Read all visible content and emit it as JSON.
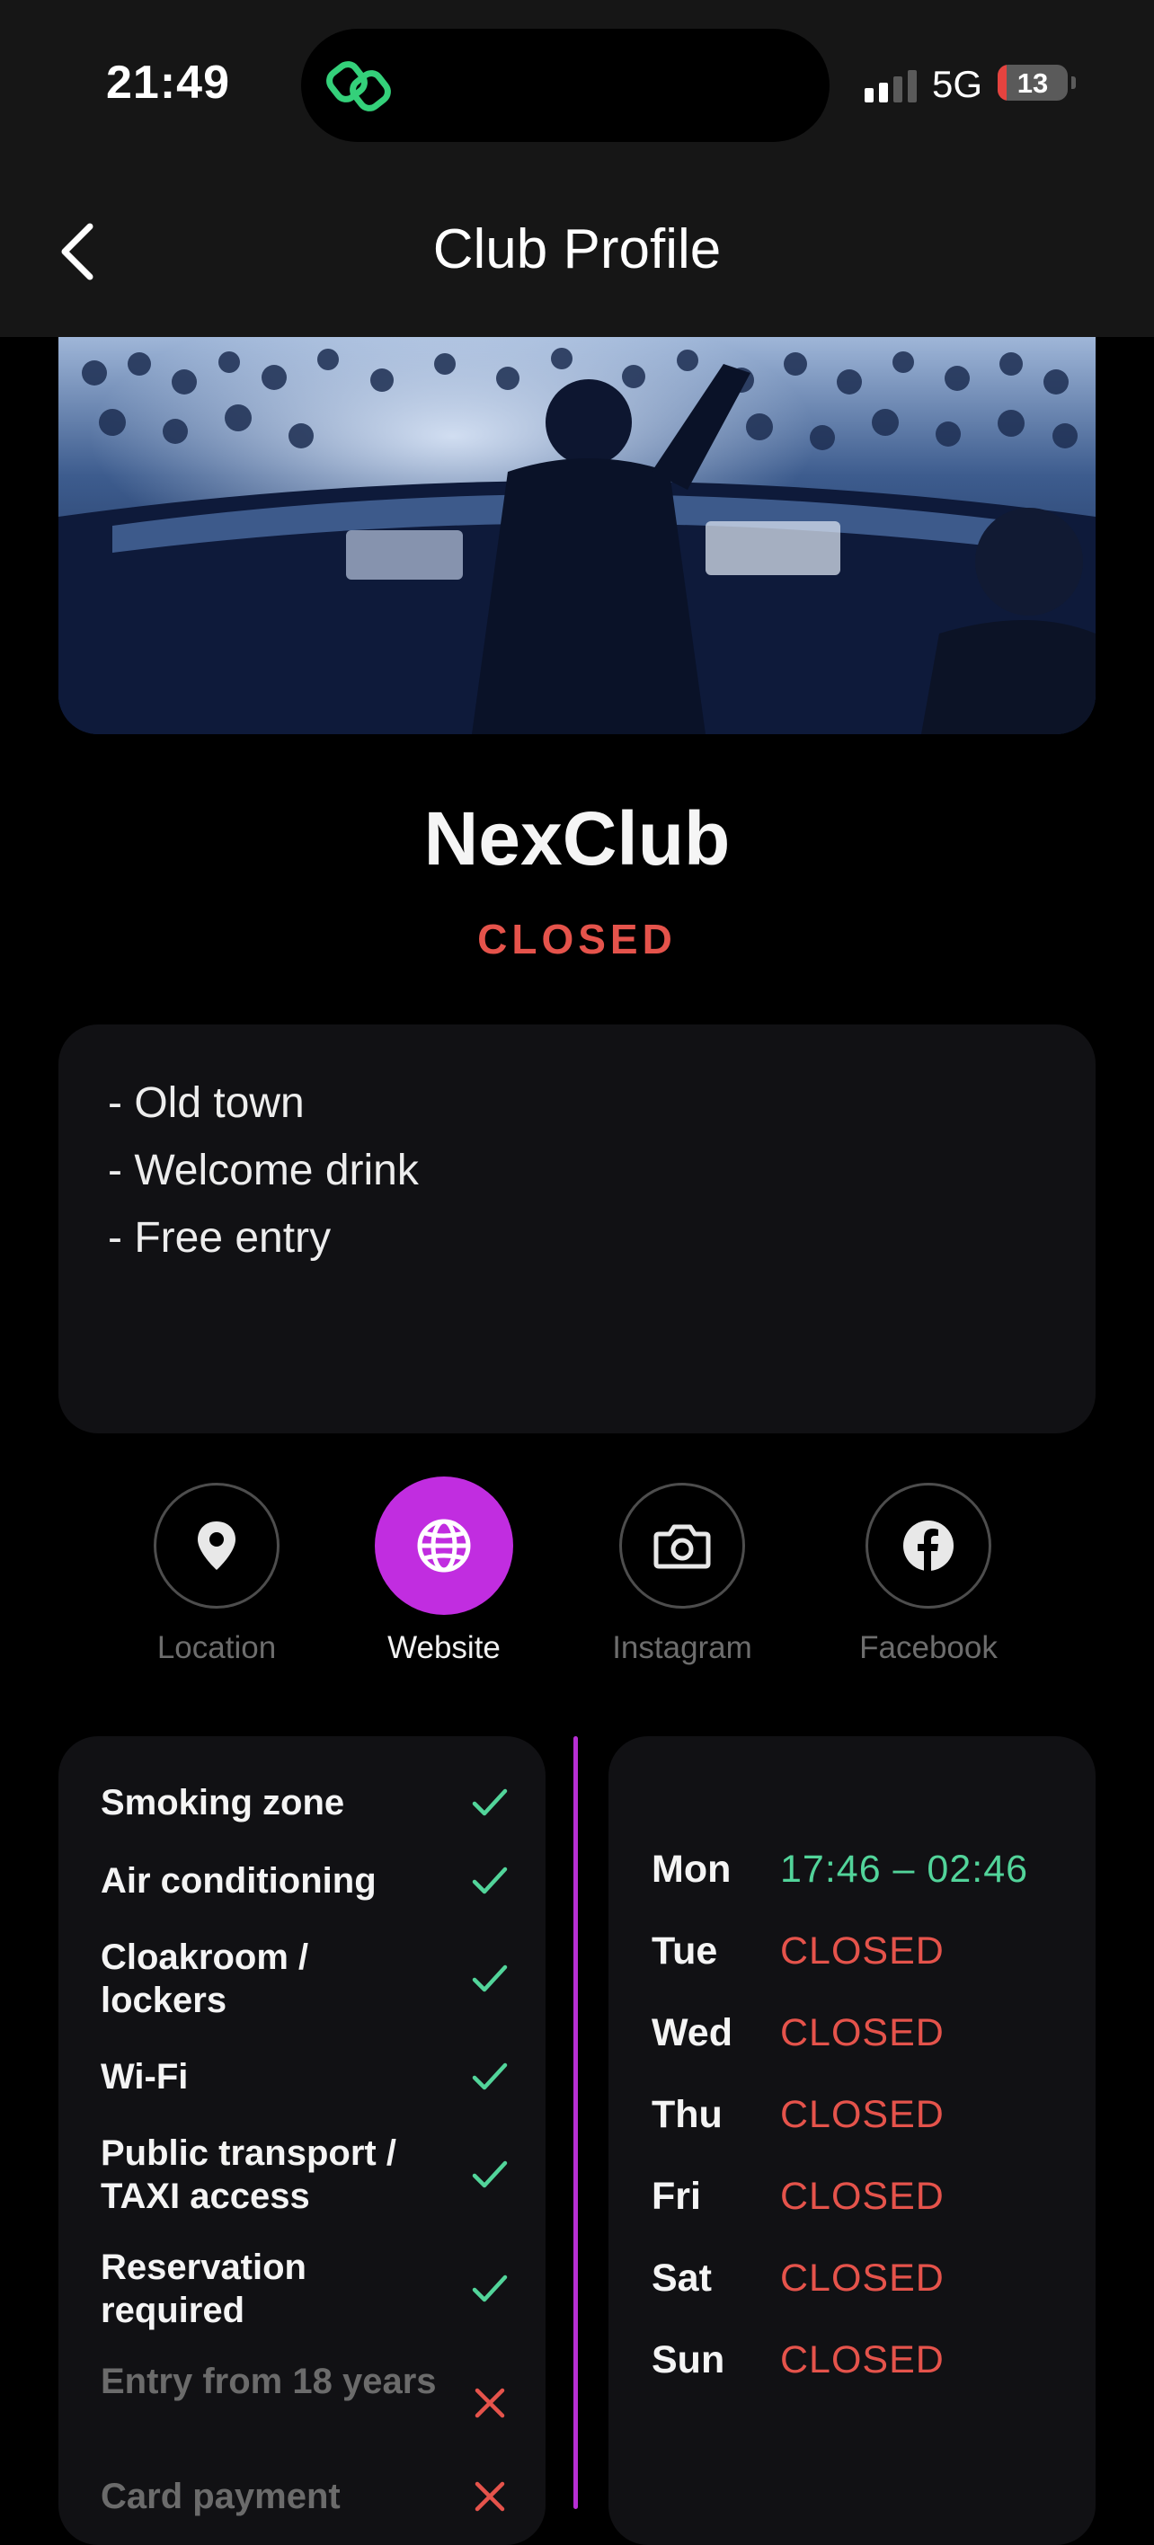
{
  "status_bar": {
    "time": "21:49",
    "network": "5G",
    "battery": "13",
    "battery_level": 0.13,
    "signal_bars_active": 2,
    "signal_bars_total": 4,
    "island_app_icon": "link-rings-icon"
  },
  "header": {
    "back_icon": "chevron-left-icon",
    "title": "Club Profile"
  },
  "club": {
    "name": "NexClub",
    "status": "CLOSED",
    "status_color": "#e5534b",
    "description": [
      "- Old town",
      "- Welcome drink",
      "- Free entry"
    ]
  },
  "actions": [
    {
      "label": "Location",
      "icon": "map-pin-icon",
      "active": false
    },
    {
      "label": "Website",
      "icon": "globe-icon",
      "active": true
    },
    {
      "label": "Instagram",
      "icon": "camera-icon",
      "active": false
    },
    {
      "label": "Facebook",
      "icon": "facebook-icon",
      "active": false
    }
  ],
  "amenities": [
    {
      "label": "Smoking zone",
      "available": true
    },
    {
      "label": "Air conditioning",
      "available": true
    },
    {
      "label": "Cloakroom / lockers",
      "available": true
    },
    {
      "label": "Wi-Fi",
      "available": true
    },
    {
      "label": "Public transport / TAXI access",
      "available": true
    },
    {
      "label": "Reservation required",
      "available": true
    },
    {
      "label": "Entry from 18 years",
      "available": false
    },
    {
      "label": "Card payment",
      "available": false
    }
  ],
  "hours": [
    {
      "day": "Mon",
      "value": "17:46 – 02:46",
      "open": true
    },
    {
      "day": "Tue",
      "value": "CLOSED",
      "open": false
    },
    {
      "day": "Wed",
      "value": "CLOSED",
      "open": false
    },
    {
      "day": "Thu",
      "value": "CLOSED",
      "open": false
    },
    {
      "day": "Fri",
      "value": "CLOSED",
      "open": false
    },
    {
      "day": "Sat",
      "value": "CLOSED",
      "open": false
    },
    {
      "day": "Sun",
      "value": "CLOSED",
      "open": false
    }
  ],
  "colors": {
    "accent": "#c12de0",
    "open": "#52d49a",
    "closed": "#e5534b",
    "check": "#52d49a",
    "cross": "#e5534b",
    "card": "#111114"
  }
}
